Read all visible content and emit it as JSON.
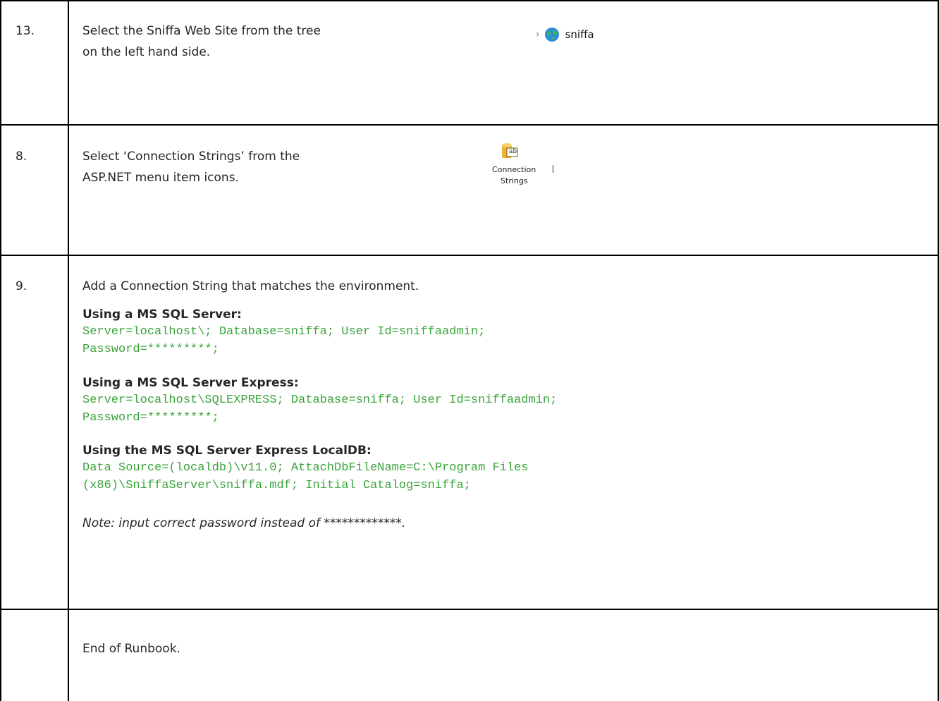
{
  "steps": [
    {
      "number": "13.",
      "line1": "Select the Sniffa Web Site from the tree",
      "line2": "on the left hand side."
    },
    {
      "number": "8.",
      "line1": "Select ‘Connection Strings’ from the",
      "line2": "ASP.NET menu item icons."
    },
    {
      "number": "9.",
      "line1": "Add a Connection String that matches the environment."
    },
    {
      "number": "",
      "line1": "End of Runbook."
    }
  ],
  "tree_figure": {
    "label": "sniffa",
    "icon": "globe-icon",
    "chevron": "chevron-right-icon"
  },
  "conn_figure": {
    "label1": "Connection",
    "label2": "Strings",
    "badge": "ab",
    "icon": "connection-strings-icon"
  },
  "blocks": [
    {
      "heading": "Using a MS SQL Server:",
      "code1": "Server=localhost\\; Database=sniffa; User Id=sniffaadmin;",
      "code2": "Password=*********;"
    },
    {
      "heading": "Using a MS SQL Server Express:",
      "code1": "Server=localhost\\SQLEXPRESS; Database=sniffa; User Id=sniffaadmin;",
      "code2": "Password=*********;"
    },
    {
      "heading": "Using the MS SQL Server Express LocalDB:",
      "code1": "Data Source=(localdb)\\v11.0; AttachDbFileName=C:\\Program Files",
      "code2": "(x86)\\SniffaServer\\sniffa.mdf; Initial Catalog=sniffa;"
    }
  ],
  "note": "Note: input correct password instead of *************.",
  "colors": {
    "code": "#3aa43a",
    "text": "#262626",
    "border": "#000000"
  }
}
